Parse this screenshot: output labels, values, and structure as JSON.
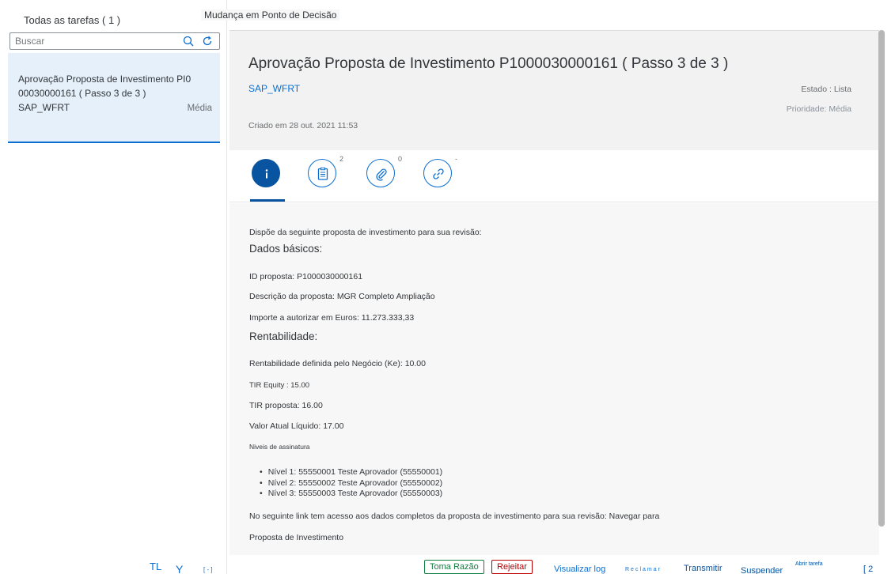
{
  "master": {
    "title": "Todas as tarefas ( 1 )",
    "search_placeholder": "Buscar",
    "task": {
      "title": "Aprovação Proposta de Investimento PI0 00030000161 ( Passo 3 de 3 )",
      "creator": "SAP_WFRT",
      "priority": "Média"
    },
    "footer": {
      "tl": "TL",
      "filter": "Y",
      "small": "[ - ]"
    }
  },
  "topbar": {
    "text": "Mudança em Ponto de Decisão"
  },
  "header": {
    "title": "Aprovação Proposta de Investimento P1000030000161 ( Passo 3 de 3 )",
    "creator": "SAP_WFRT",
    "status": "Estado : Lista",
    "priority": "Prioridade: Média",
    "created": "Criado em 28 out. 2021 11:53"
  },
  "tabs": [
    {
      "name": "info",
      "count": ""
    },
    {
      "name": "notes",
      "count": "2"
    },
    {
      "name": "attachments",
      "count": "0"
    },
    {
      "name": "links",
      "count": "-"
    }
  ],
  "content": {
    "intro": "Dispõe da seguinte proposta de investimento para sua revisão:",
    "basic_heading": "Dados básicos:",
    "proposal_id": "ID proposta: P1000030000161",
    "description": "Descrição da proposta: MGR Completo Ampliação",
    "amount": "Importe a autorizar em Euros: 11.273.333,33",
    "profit_heading": "Rentabilidade:",
    "ke": "Rentabilidade definida pelo Negócio (Ke): 10.00",
    "tir_equity": "TIR Equity : 15.00",
    "tir_proposal": "TIR proposta: 16.00",
    "npv": "Valor Atual Líquido: 17.00",
    "signature_heading": "Niveis de assinatura",
    "levels": [
      "Nível 1: 55550001 Teste Aprovador (55550001)",
      "Nível 2: 55550002 Teste Aprovador (55550002)",
      "Nível 3: 55550003 Teste Aprovador (55550003)"
    ],
    "link_text": "No seguinte link tem acesso aos dados completos da proposta de investimento para sua revisão: Navegar para",
    "link_label": "Proposta de Investimento"
  },
  "footer": {
    "approve": "Toma Razão",
    "reject": "Rejeitar",
    "view_log": "Visualizar log",
    "claim": "Reclamar",
    "forward": "Transmitir",
    "suspend": "Suspender",
    "open_task": "Abrir tarefa",
    "more": "[ 2"
  },
  "colors": {
    "accent": "#0a6ed1",
    "accept": "#107e3e",
    "reject": "#bb0000",
    "selected_bg": "#e5f0fa"
  }
}
